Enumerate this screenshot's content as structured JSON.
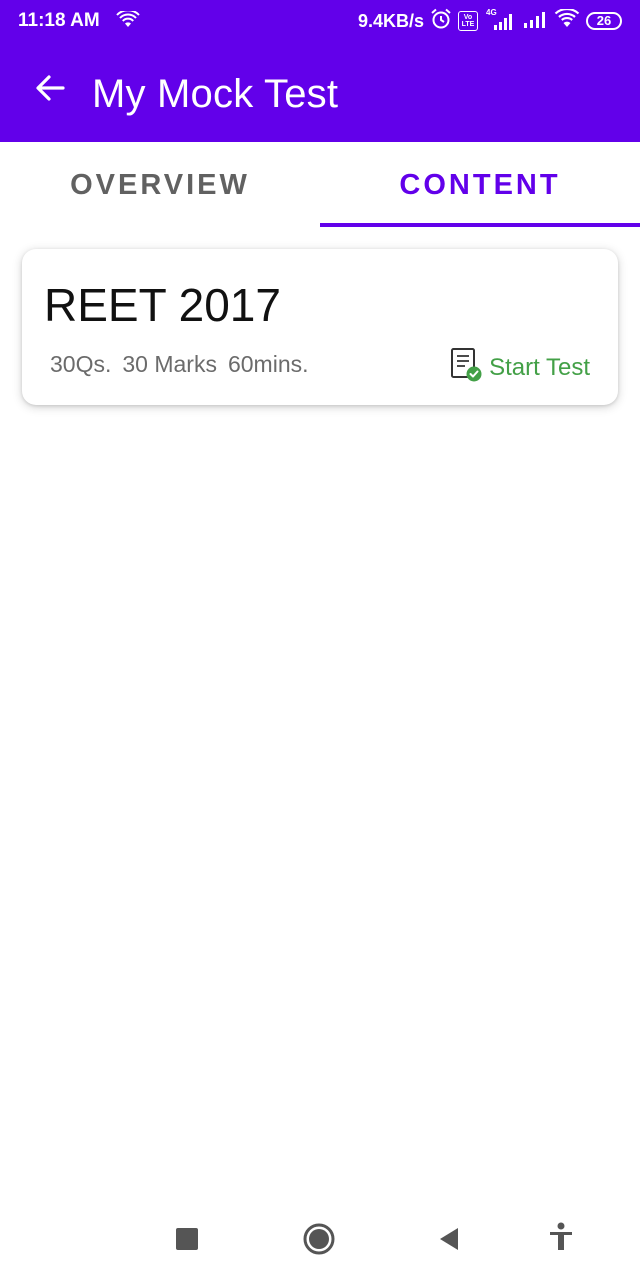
{
  "status_bar": {
    "time": "11:18 AM",
    "network_speed": "9.4KB/s",
    "lte_top": "Vo",
    "lte_bottom": "LTE",
    "network_type": "4G",
    "battery": "26"
  },
  "app_bar": {
    "title": "My Mock Test",
    "background": "#6200ea"
  },
  "tabs": [
    {
      "label": "OVERVIEW",
      "selected": false
    },
    {
      "label": "CONTENT",
      "selected": true
    }
  ],
  "test_card": {
    "title": "REET 2017",
    "questions": "30Qs.",
    "marks": "30 Marks",
    "duration": "60mins.",
    "action_label": "Start Test",
    "action_icon": "test-check-icon",
    "action_color": "#43a047"
  },
  "nav_bar": {
    "icons": [
      "recents-icon",
      "home-icon",
      "back-icon",
      "accessibility-icon"
    ]
  }
}
